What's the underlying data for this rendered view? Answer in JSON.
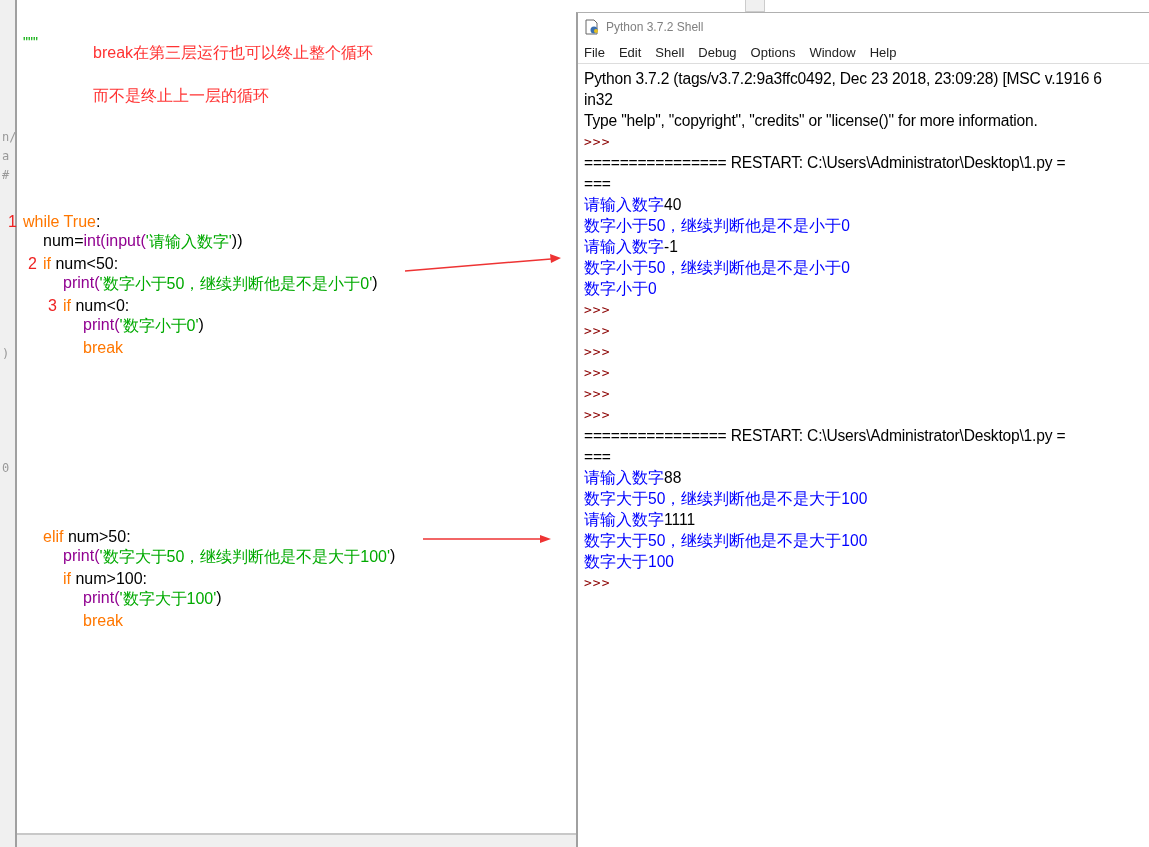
{
  "background_window": {
    "fragments": [
      "n/",
      "a",
      "#",
      ")",
      "0"
    ]
  },
  "editor": {
    "doc_marker": "\"\"\"",
    "notes": [
      "break在第三层运行也可以终止整个循环",
      "而不是终止上一层的循环"
    ],
    "code": [
      {
        "marker": "1",
        "tokens": [
          {
            "kind": "keyword",
            "text": "while True"
          },
          {
            "kind": "plain",
            "text": ":"
          }
        ],
        "children": [
          {
            "tokens": [
              {
                "kind": "plain",
                "text": "num="
              },
              {
                "kind": "builtin",
                "text": "int(input("
              },
              {
                "kind": "string",
                "text": "'请输入数字'"
              },
              {
                "kind": "plain",
                "text": "))"
              }
            ]
          },
          {
            "marker": "2",
            "tokens": [
              {
                "kind": "keyword",
                "text": "if"
              },
              {
                "kind": "plain",
                "text": " num<50:"
              }
            ],
            "arrow": true,
            "children": [
              {
                "tokens": [
                  {
                    "kind": "builtin",
                    "text": "print("
                  },
                  {
                    "kind": "string",
                    "text": "'数字小于50，继续判断他是不是小于0'"
                  },
                  {
                    "kind": "plain",
                    "text": ")"
                  }
                ]
              },
              {
                "marker": "3",
                "tokens": [
                  {
                    "kind": "keyword",
                    "text": "if"
                  },
                  {
                    "kind": "plain",
                    "text": " num<0:"
                  }
                ],
                "children": [
                  {
                    "tokens": [
                      {
                        "kind": "builtin",
                        "text": "print("
                      },
                      {
                        "kind": "string",
                        "text": "'数字小于0'"
                      },
                      {
                        "kind": "plain",
                        "text": ")"
                      }
                    ]
                  },
                  {
                    "tokens": [
                      {
                        "kind": "keyword",
                        "text": "break"
                      }
                    ]
                  }
                ]
              }
            ]
          },
          {
            "spaced": true,
            "tokens": [
              {
                "kind": "keyword",
                "text": "elif"
              },
              {
                "kind": "plain",
                "text": " num>50:"
              }
            ],
            "arrow": true,
            "children": [
              {
                "tokens": [
                  {
                    "kind": "builtin",
                    "text": "print("
                  },
                  {
                    "kind": "string",
                    "text": "'数字大于50，继续判断他是不是大于100'"
                  },
                  {
                    "kind": "plain",
                    "text": ")"
                  }
                ]
              },
              {
                "tokens": [
                  {
                    "kind": "keyword",
                    "text": "if"
                  },
                  {
                    "kind": "plain",
                    "text": " num>100:"
                  }
                ],
                "children": [
                  {
                    "tokens": [
                      {
                        "kind": "builtin",
                        "text": "print("
                      },
                      {
                        "kind": "string",
                        "text": "'数字大于100'"
                      },
                      {
                        "kind": "plain",
                        "text": ")"
                      }
                    ]
                  },
                  {
                    "tokens": [
                      {
                        "kind": "keyword",
                        "text": "break"
                      }
                    ]
                  }
                ]
              }
            ]
          }
        ]
      }
    ]
  },
  "shell": {
    "title": "Python 3.7.2 Shell",
    "menu": [
      "File",
      "Edit",
      "Shell",
      "Debug",
      "Options",
      "Window",
      "Help"
    ],
    "lines": [
      {
        "kind": "plain",
        "text": "Python 3.7.2 (tags/v3.7.2:9a3ffc0492, Dec 23 2018, 23:09:28) [MSC v.1916 6"
      },
      {
        "kind": "plain",
        "text": "in32"
      },
      {
        "kind": "plain",
        "text": "Type \"help\", \"copyright\", \"credits\" or \"license()\" for more information."
      },
      {
        "kind": "prompt",
        "text": ">>>"
      },
      {
        "kind": "plain",
        "text": "================ RESTART: C:\\Users\\Administrator\\Desktop\\1.py ="
      },
      {
        "kind": "plain",
        "text": "==="
      },
      {
        "kind": "input",
        "text": "请输入数字",
        "value": "40"
      },
      {
        "kind": "output",
        "text": "数字小于50，继续判断他是不是小于0"
      },
      {
        "kind": "input",
        "text": "请输入数字",
        "value": "-1"
      },
      {
        "kind": "output",
        "text": "数字小于50，继续判断他是不是小于0"
      },
      {
        "kind": "output",
        "text": "数字小于0"
      },
      {
        "kind": "prompt",
        "text": ">>>"
      },
      {
        "kind": "prompt",
        "text": ">>>"
      },
      {
        "kind": "prompt",
        "text": ">>>"
      },
      {
        "kind": "prompt",
        "text": ">>>"
      },
      {
        "kind": "prompt",
        "text": ">>>"
      },
      {
        "kind": "prompt",
        "text": ">>>"
      },
      {
        "kind": "plain",
        "text": "================ RESTART: C:\\Users\\Administrator\\Desktop\\1.py ="
      },
      {
        "kind": "plain",
        "text": "==="
      },
      {
        "kind": "input",
        "text": "请输入数字",
        "value": "88"
      },
      {
        "kind": "output",
        "text": "数字大于50，继续判断他是不是大于100"
      },
      {
        "kind": "input",
        "text": "请输入数字",
        "value": "1111"
      },
      {
        "kind": "output",
        "text": "数字大于50，继续判断他是不是大于100"
      },
      {
        "kind": "output",
        "text": "数字大于100"
      },
      {
        "kind": "prompt",
        "text": ">>>"
      }
    ]
  }
}
